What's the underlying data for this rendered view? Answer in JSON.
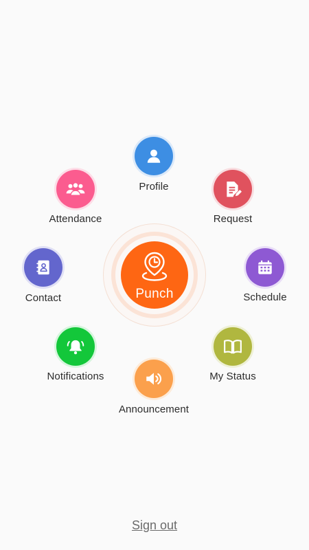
{
  "center": {
    "punch_label": "Punch",
    "icon": "location-clock-icon",
    "color": "#fe6613"
  },
  "menu": {
    "profile": {
      "label": "Profile",
      "icon": "person-icon",
      "color": "#3d8ee3"
    },
    "request": {
      "label": "Request",
      "icon": "document-edit-icon",
      "color": "#e0525e"
    },
    "schedule": {
      "label": "Schedule",
      "icon": "calendar-icon",
      "color": "#8e59d3"
    },
    "my_status": {
      "label": "My Status",
      "icon": "book-icon",
      "color": "#b0b73f"
    },
    "announcement": {
      "label": "Announcement",
      "icon": "speaker-icon",
      "color": "#fba04c"
    },
    "notifications": {
      "label": "Notifications",
      "icon": "bell-icon",
      "color": "#13c73a"
    },
    "contact": {
      "label": "Contact",
      "icon": "contact-book-icon",
      "color": "#6366cd"
    },
    "attendance": {
      "label": "Attendance",
      "icon": "group-icon",
      "color": "#fb5c8f"
    }
  },
  "footer": {
    "sign_out_label": "Sign out"
  }
}
